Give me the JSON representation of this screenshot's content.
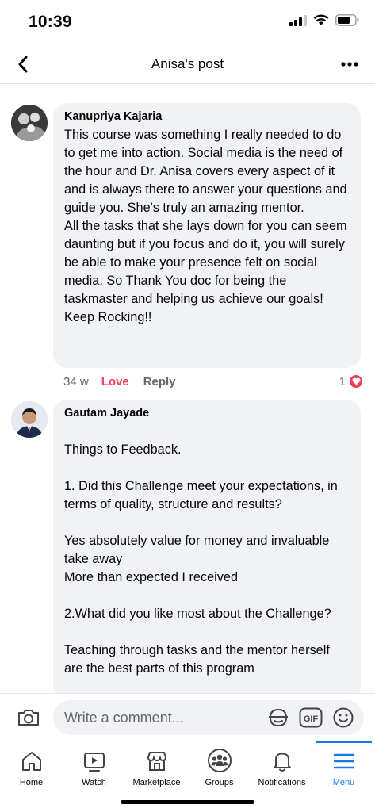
{
  "status": {
    "time": "10:39"
  },
  "nav": {
    "title": "Anisa's post"
  },
  "comments": [
    {
      "author": "Kanupriya Kajaria",
      "text": "This course was something I really needed to do to get me into action. Social media is the need of the hour and Dr. Anisa covers every aspect of it and is always there to answer your questions and guide you. She's truly an amazing mentor.\nAll the tasks that she lays down for you can seem daunting but if you focus and do it, you will surely be able to make your presence felt on social media. So Thank You doc for being the taskmaster and helping us achieve our goals!\nKeep Rocking!!",
      "time": "34 w",
      "love_label": "Love",
      "reply_label": "Reply",
      "reaction_count": "1"
    },
    {
      "author": "Gautam Jayade",
      "text": "\nThings to Feedback.\n\n1. Did this Challenge meet your expectations, in terms of quality, structure and results?\n\nYes absolutely value for money and invaluable take away\nMore than expected I received\n\n2.What did you like most about the Challenge?\n\nTeaching through tasks and the mentor herself are the best parts of this program"
    }
  ],
  "composer": {
    "placeholder": "Write a comment...",
    "gif_label": "GIF"
  },
  "tabs": [
    {
      "label": "Home",
      "icon": "home-icon"
    },
    {
      "label": "Watch",
      "icon": "watch-icon"
    },
    {
      "label": "Marketplace",
      "icon": "marketplace-icon"
    },
    {
      "label": "Groups",
      "icon": "groups-icon"
    },
    {
      "label": "Notifications",
      "icon": "bell-icon"
    },
    {
      "label": "Menu",
      "icon": "menu-icon",
      "active": true
    }
  ],
  "colors": {
    "accent": "#1877f2",
    "love": "#f33e58",
    "bubble": "#f0f2f5",
    "secondary_text": "#65676b"
  }
}
